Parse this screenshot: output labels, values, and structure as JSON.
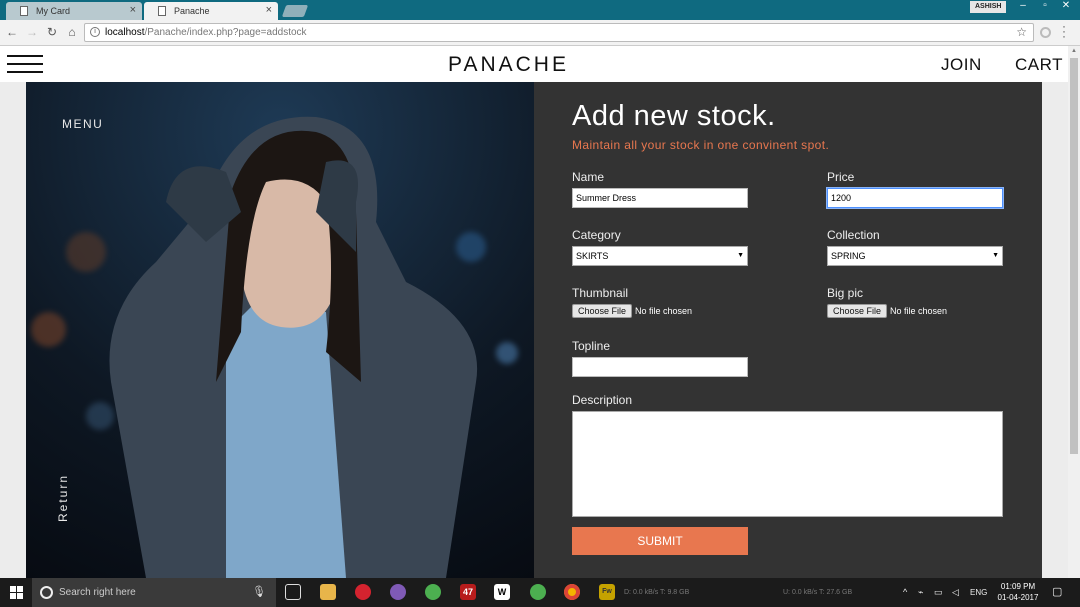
{
  "browser": {
    "tabs": [
      {
        "title": "My Card",
        "active": false
      },
      {
        "title": "Panache",
        "active": true
      }
    ],
    "user": "ASHISH",
    "url_host": "localhost",
    "url_path": "/Panache/index.php?page=addstock"
  },
  "site": {
    "logo": "PANACHE",
    "nav": {
      "join": "JOIN",
      "cart": "CART"
    },
    "photo_menu": "MENU",
    "photo_return": "Return"
  },
  "form": {
    "title": "Add new stock.",
    "subtitle": "Maintain all your stock in one convinent spot.",
    "name_label": "Name",
    "name_value": "Summer Dress",
    "price_label": "Price",
    "price_value": "1200",
    "category_label": "Category",
    "category_value": "SKIRTS",
    "collection_label": "Collection",
    "collection_value": "SPRING",
    "thumbnail_label": "Thumbnail",
    "bigpic_label": "Big pic",
    "choose_file": "Choose File",
    "no_file": "No file chosen",
    "topline_label": "Topline",
    "description_label": "Description",
    "submit": "SUBMIT",
    "accent_color": "#e8774f"
  },
  "taskbar": {
    "search_placeholder": "Search right here",
    "badge_count": "47",
    "net_down": "D: 0.0 kB/s T: 9.8 GB",
    "net_up": "U: 0.0 kB/s T: 27.6 GB",
    "lang": "ENG",
    "time": "01:09 PM",
    "date": "01-04-2017"
  }
}
